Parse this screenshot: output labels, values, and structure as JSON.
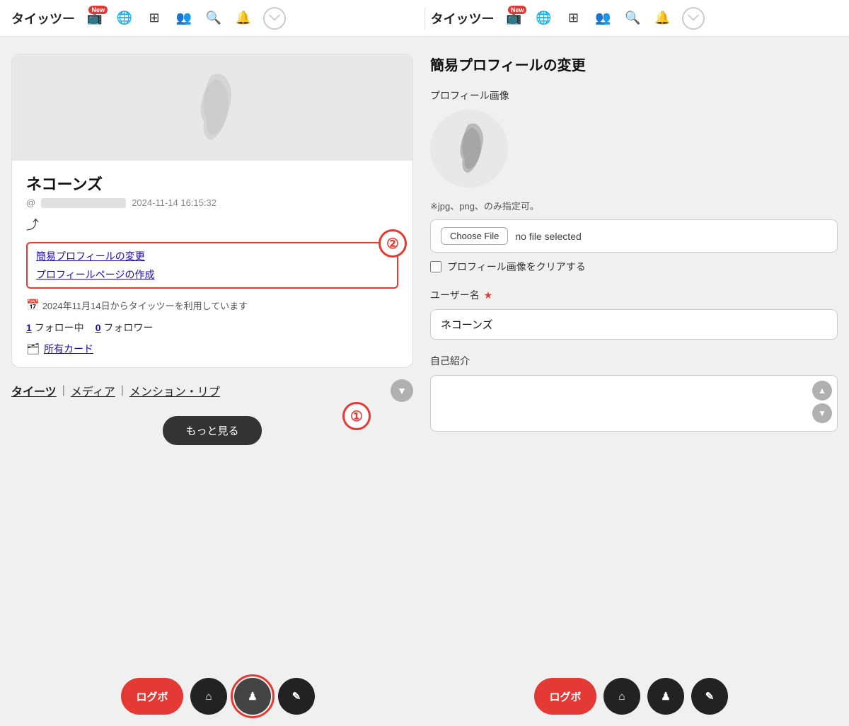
{
  "navbar": {
    "logo": "タイッツー",
    "badge": "New",
    "icons": [
      "tv-icon",
      "globe-icon",
      "grid-icon",
      "people-icon",
      "search-icon",
      "bell-icon"
    ],
    "profile_circle": "/"
  },
  "profile": {
    "name": "ネコーンズ",
    "handle_placeholder": "",
    "date": "2024-11-14 16:15:32",
    "links": {
      "edit_profile": "簡易プロフィールの変更",
      "create_profile": "プロフィールページの作成"
    },
    "since": "2024年11月14日からタイッツーを利用しています",
    "following_count": "1",
    "following_label": "フォロー中",
    "followers_count": "0",
    "followers_label": "フォロワー",
    "cards_label": "所有カード"
  },
  "tabs": {
    "items": [
      {
        "label": "タイーツ",
        "active": true
      },
      {
        "label": "メディア",
        "active": false
      },
      {
        "label": "メンション・リプ",
        "active": false
      }
    ]
  },
  "bottom_nav": {
    "logbo": "ログボ",
    "home_icon": "⌂",
    "user_icon": "♟",
    "edit_icon": "✎"
  },
  "right_panel": {
    "title": "簡易プロフィールの変更",
    "avatar_label": "プロフィール画像",
    "hint_text": "※jpg、png、のみ指定可。",
    "choose_file_label": "Choose File",
    "file_name": "no file selected",
    "clear_checkbox_label": "プロフィール画像をクリアする",
    "username_label": "ユーザー名",
    "username_value": "ネコーンズ",
    "bio_label": "自己紹介",
    "bio_value": ""
  },
  "step_markers": {
    "step1": "①",
    "step2": "②"
  },
  "more_button": "もっと見る"
}
